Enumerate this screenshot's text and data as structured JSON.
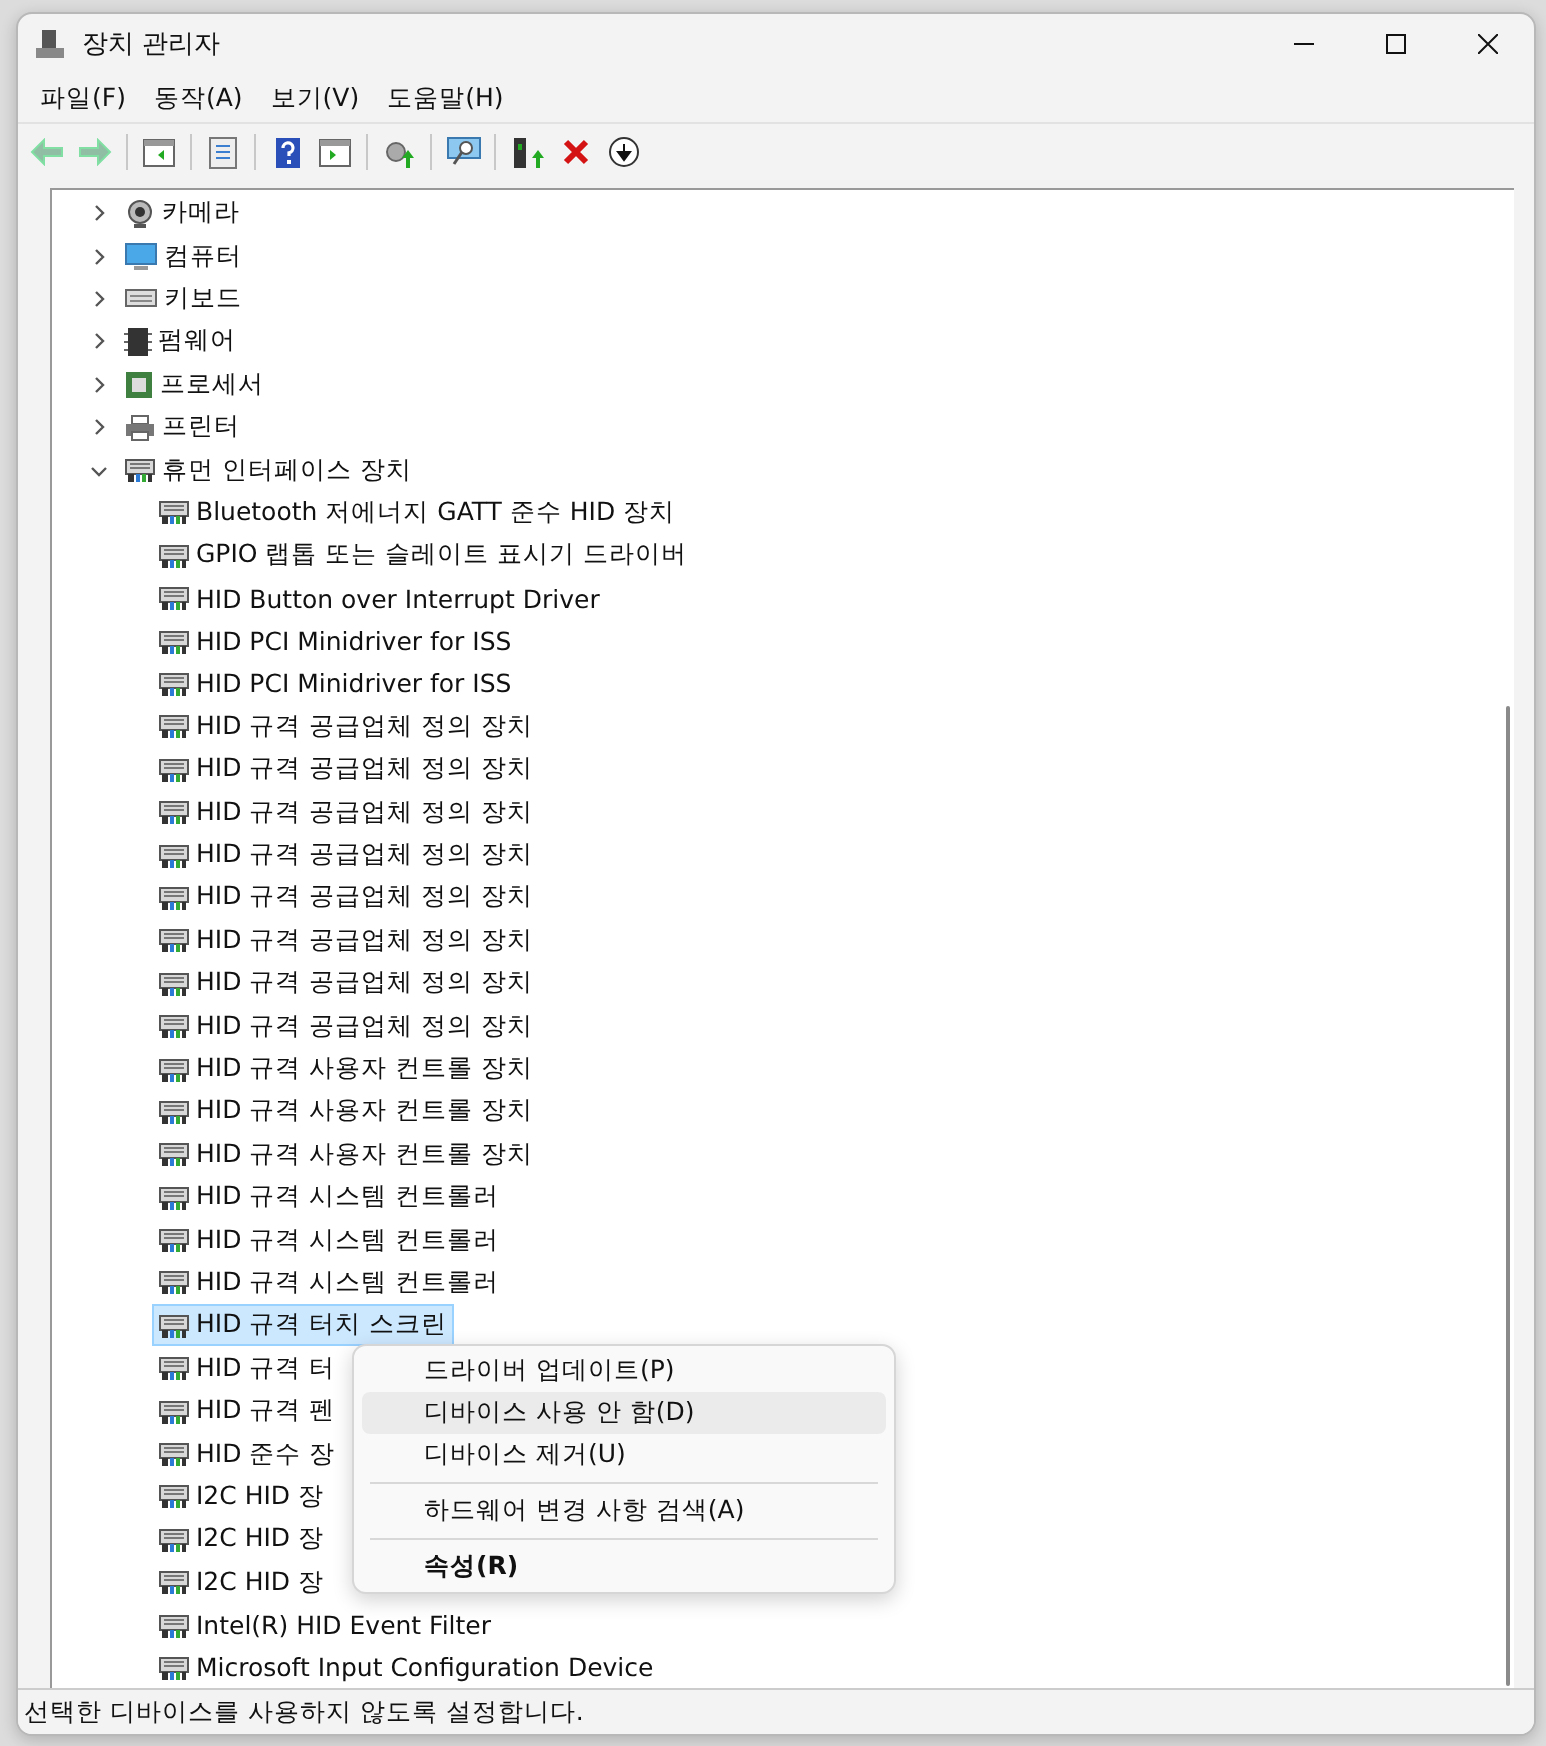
{
  "window": {
    "title": "장치 관리자"
  },
  "menu": [
    "파일(F)",
    "동작(A)",
    "보기(V)",
    "도움말(H)"
  ],
  "toolbar": [
    {
      "kind": "back",
      "disabled": true
    },
    {
      "kind": "forward",
      "disabled": true
    },
    {
      "kind": "separator"
    },
    {
      "kind": "tree-pane",
      "disabled": false
    },
    {
      "kind": "separator"
    },
    {
      "kind": "properties",
      "disabled": false
    },
    {
      "kind": "separator"
    },
    {
      "kind": "help",
      "disabled": false
    },
    {
      "kind": "action-pane",
      "disabled": false
    },
    {
      "kind": "separator"
    },
    {
      "kind": "update",
      "disabled": false
    },
    {
      "kind": "separator"
    },
    {
      "kind": "scan",
      "disabled": false
    },
    {
      "kind": "separator"
    },
    {
      "kind": "enable",
      "disabled": false
    },
    {
      "kind": "remove",
      "disabled": false
    },
    {
      "kind": "disable",
      "disabled": false
    }
  ],
  "tree": [
    {
      "label": "카메라",
      "kind": "camera",
      "expanded": false
    },
    {
      "label": "컴퓨터",
      "kind": "computer",
      "expanded": false
    },
    {
      "label": "키보드",
      "kind": "keyboard",
      "expanded": false
    },
    {
      "label": "펌웨어",
      "kind": "firmware",
      "expanded": false
    },
    {
      "label": "프로세서",
      "kind": "processor",
      "expanded": false
    },
    {
      "label": "프린터",
      "kind": "printer",
      "expanded": false
    },
    {
      "label": "휴먼 인터페이스 장치",
      "kind": "hid",
      "expanded": true,
      "children": [
        {
          "label": "Bluetooth 저에너지 GATT 준수 HID 장치",
          "selected": false
        },
        {
          "label": "GPIO 랩톱 또는 슬레이트 표시기 드라이버",
          "selected": false
        },
        {
          "label": "HID Button over Interrupt Driver",
          "selected": false
        },
        {
          "label": "HID PCI Minidriver for ISS",
          "selected": false
        },
        {
          "label": "HID PCI Minidriver for ISS",
          "selected": false
        },
        {
          "label": "HID 규격 공급업체 정의 장치",
          "selected": false
        },
        {
          "label": "HID 규격 공급업체 정의 장치",
          "selected": false
        },
        {
          "label": "HID 규격 공급업체 정의 장치",
          "selected": false
        },
        {
          "label": "HID 규격 공급업체 정의 장치",
          "selected": false
        },
        {
          "label": "HID 규격 공급업체 정의 장치",
          "selected": false
        },
        {
          "label": "HID 규격 공급업체 정의 장치",
          "selected": false
        },
        {
          "label": "HID 규격 공급업체 정의 장치",
          "selected": false
        },
        {
          "label": "HID 규격 공급업체 정의 장치",
          "selected": false
        },
        {
          "label": "HID 규격 사용자 컨트롤 장치",
          "selected": false
        },
        {
          "label": "HID 규격 사용자 컨트롤 장치",
          "selected": false
        },
        {
          "label": "HID 규격 사용자 컨트롤 장치",
          "selected": false
        },
        {
          "label": "HID 규격 시스템 컨트롤러",
          "selected": false
        },
        {
          "label": "HID 규격 시스템 컨트롤러",
          "selected": false
        },
        {
          "label": "HID 규격 시스템 컨트롤러",
          "selected": false
        },
        {
          "label": "HID 규격 터치 스크린",
          "selected": true
        },
        {
          "label": "HID 규격 터",
          "selected": false
        },
        {
          "label": "HID 규격 펜",
          "selected": false
        },
        {
          "label": "HID 준수 장",
          "selected": false
        },
        {
          "label": "I2C HID 장",
          "selected": false
        },
        {
          "label": "I2C HID 장",
          "selected": false
        },
        {
          "label": "I2C HID 장",
          "selected": false
        },
        {
          "label": "Intel(R) HID Event Filter",
          "selected": false
        },
        {
          "label": "Microsoft Input Configuration Device",
          "selected": false
        }
      ]
    }
  ],
  "context_menu": [
    {
      "kind": "item",
      "label": "드라이버 업데이트(P)",
      "highlighted": false,
      "default": false
    },
    {
      "kind": "item",
      "label": "디바이스 사용 안 함(D)",
      "highlighted": true,
      "default": false
    },
    {
      "kind": "item",
      "label": "디바이스 제거(U)",
      "highlighted": false,
      "default": false
    },
    {
      "kind": "separator"
    },
    {
      "kind": "item",
      "label": "하드웨어 변경 사항 검색(A)",
      "highlighted": false,
      "default": false
    },
    {
      "kind": "separator"
    },
    {
      "kind": "item",
      "label": "속성(R)",
      "highlighted": false,
      "default": true
    }
  ],
  "status_bar": "선택한 디바이스를 사용하지 않도록 설정합니다."
}
